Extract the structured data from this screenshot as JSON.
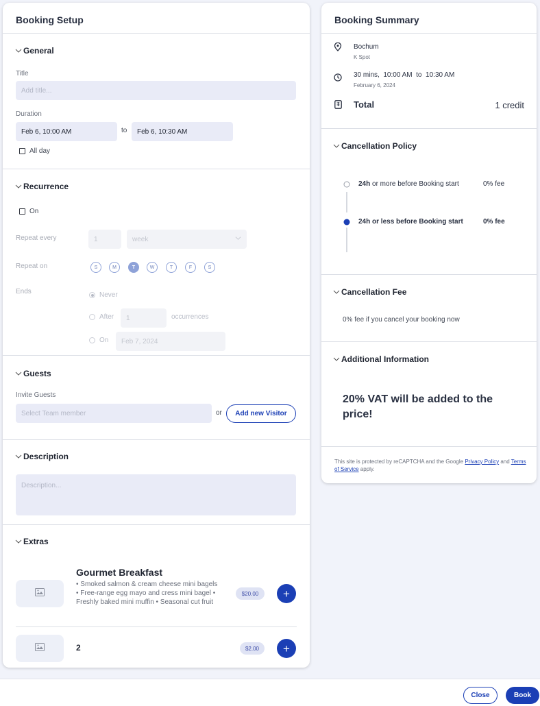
{
  "setup": {
    "title": "Booking Setup",
    "general": {
      "heading": "General",
      "title_label": "Title",
      "title_placeholder": "Add title...",
      "duration_label": "Duration",
      "start": "Feb 6, 10:00 AM",
      "to": "to",
      "end": "Feb 6, 10:30 AM",
      "all_day": "All day"
    },
    "recurrence": {
      "heading": "Recurrence",
      "on_label": "On",
      "repeat_every_label": "Repeat every",
      "repeat_value": "1",
      "repeat_unit": "week",
      "repeat_on_label": "Repeat on",
      "days": [
        "S",
        "M",
        "T",
        "W",
        "T",
        "F",
        "S"
      ],
      "active_day": 2,
      "ends_label": "Ends",
      "never": "Never",
      "after": "After",
      "after_value": "1",
      "occurrences": "occurrences",
      "on": "On",
      "on_date": "Feb 7, 2024"
    },
    "guests": {
      "heading": "Guests",
      "invite_label": "Invite Guests",
      "select_placeholder": "Select Team member",
      "or": "or",
      "add_visitor": "Add new Visitor"
    },
    "description": {
      "heading": "Description",
      "placeholder": "Description..."
    },
    "extras": {
      "heading": "Extras",
      "items": [
        {
          "name": "Gourmet Breakfast",
          "desc": "• Smoked salmon & cream cheese mini bagels • Free-range egg mayo and cress mini bagel • Freshly baked mini muffin • Seasonal cut fruit",
          "price": "$20.00"
        },
        {
          "name": "2",
          "desc": "",
          "price": "$2.00"
        }
      ],
      "add_symbol": "+"
    }
  },
  "summary": {
    "title": "Booking Summary",
    "location": "Bochum",
    "spot": "K Spot",
    "time": "30 mins,  10:00 AM  to  10:30 AM",
    "date": "February 6, 2024",
    "total_label": "Total",
    "total_value": "1 credit",
    "cancellation_policy": {
      "heading": "Cancellation Policy",
      "rows": [
        {
          "bold": "24h",
          "rest": " or more before Booking start",
          "fee": "0% fee"
        },
        {
          "bold": "24h or less before Booking start",
          "rest": "",
          "fee": "0% fee"
        }
      ]
    },
    "cancellation_fee": {
      "heading": "Cancellation Fee",
      "text": "0% fee if you cancel your booking now"
    },
    "additional": {
      "heading": "Additional Information",
      "text": "20% VAT will be added to the price!"
    },
    "recaptcha": {
      "prefix": "This site is protected by reCAPTCHA and the Google ",
      "privacy": "Privacy Policy",
      "mid": " and ",
      "terms": "Terms of Service",
      "suffix": " apply."
    }
  },
  "footer": {
    "close": "Close",
    "book": "Book"
  },
  "colors": {
    "accent": "#1b3fb5",
    "field_bg": "#e9ebf7",
    "page_bg": "#f1f3fa"
  }
}
